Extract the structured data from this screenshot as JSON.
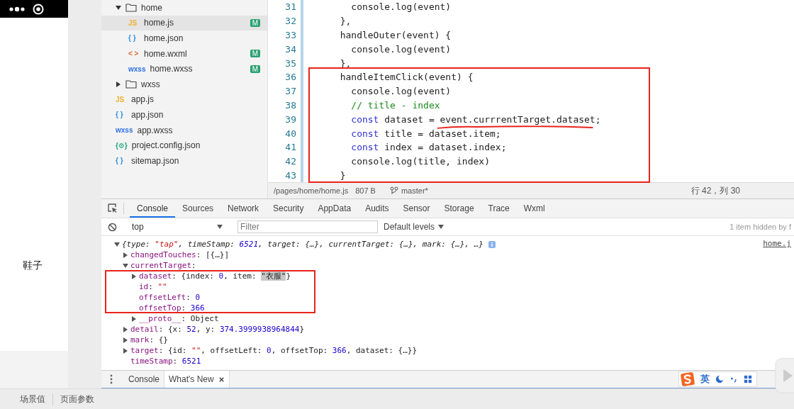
{
  "simulator": {
    "item_label": "鞋子"
  },
  "file_tree": [
    {
      "name": "home",
      "kind": "folder",
      "expanded": true,
      "selected": false,
      "children": [
        {
          "name": "home.js",
          "kind": "js",
          "icon_text": "JS",
          "badge": "M",
          "selected": true
        },
        {
          "name": "home.json",
          "kind": "json",
          "icon_text": "{ }",
          "selected": false
        },
        {
          "name": "home.wxml",
          "kind": "wxml",
          "icon_text": "< >",
          "badge": "M",
          "selected": false
        },
        {
          "name": "home.wxss",
          "kind": "wxss",
          "icon_text": "wxss",
          "badge": "M",
          "selected": false
        }
      ]
    },
    {
      "name": "wxss",
      "kind": "folder",
      "expanded": false,
      "selected": false
    },
    {
      "name": "app.js",
      "kind": "js",
      "icon_text": "JS",
      "selected": false
    },
    {
      "name": "app.json",
      "kind": "json",
      "icon_text": "{ }",
      "selected": false
    },
    {
      "name": "app.wxss",
      "kind": "wxss",
      "icon_text": "wxss",
      "selected": false
    },
    {
      "name": "project.config.json",
      "kind": "config",
      "icon_text": "{⚙}",
      "selected": false
    },
    {
      "name": "sitemap.json",
      "kind": "json",
      "icon_text": "{ }",
      "selected": false
    }
  ],
  "editor": {
    "lines": [
      {
        "number": "31",
        "tokens": [
          {
            "kind": "plain",
            "text": "    console.log(event)"
          }
        ]
      },
      {
        "number": "32",
        "tokens": [
          {
            "kind": "plain",
            "text": "  },"
          }
        ]
      },
      {
        "number": "33",
        "tokens": [
          {
            "kind": "plain",
            "text": "  handleOuter(event) {"
          }
        ]
      },
      {
        "number": "34",
        "tokens": [
          {
            "kind": "plain",
            "text": "    console.log(event)"
          }
        ]
      },
      {
        "number": "35",
        "tokens": [
          {
            "kind": "plain",
            "text": "  },"
          }
        ]
      },
      {
        "number": "36",
        "tokens": [
          {
            "kind": "plain",
            "text": "  handleItemClick(event) {"
          }
        ]
      },
      {
        "number": "37",
        "tokens": [
          {
            "kind": "plain",
            "text": "    console.log(event)"
          }
        ]
      },
      {
        "number": "38",
        "tokens": [
          {
            "kind": "comment",
            "text": "    // title - index"
          }
        ]
      },
      {
        "number": "39",
        "tokens": [
          {
            "kind": "keyword",
            "text": "    const"
          },
          {
            "kind": "plain",
            "text": " dataset = event.currrentTarget.dataset;"
          }
        ]
      },
      {
        "number": "40",
        "tokens": [
          {
            "kind": "keyword",
            "text": "    const"
          },
          {
            "kind": "plain",
            "text": " title = dataset.item;"
          }
        ]
      },
      {
        "number": "41",
        "tokens": [
          {
            "kind": "keyword",
            "text": "    const"
          },
          {
            "kind": "plain",
            "text": " index = dataset.index;"
          }
        ]
      },
      {
        "number": "42",
        "tokens": [
          {
            "kind": "plain",
            "text": "    console.log(title, index)"
          }
        ]
      },
      {
        "number": "43",
        "tokens": [
          {
            "kind": "plain",
            "text": "  }"
          }
        ]
      }
    ],
    "status": {
      "path": "/pages/home/home.js",
      "size": "807 B",
      "branch": "master*",
      "position": "行 42，列 30"
    }
  },
  "devtools": {
    "tabs": [
      {
        "label": "Console",
        "selected": true
      },
      {
        "label": "Sources",
        "selected": false
      },
      {
        "label": "Network",
        "selected": false
      },
      {
        "label": "Security",
        "selected": false
      },
      {
        "label": "AppData",
        "selected": false
      },
      {
        "label": "Audits",
        "selected": false
      },
      {
        "label": "Sensor",
        "selected": false
      },
      {
        "label": "Storage",
        "selected": false
      },
      {
        "label": "Trace",
        "selected": false
      },
      {
        "label": "Wxml",
        "selected": false
      }
    ],
    "context": "top",
    "filter_placeholder": "Filter",
    "levels": "Default levels",
    "hidden_note": "1 item hidden by f",
    "source_link": "home.j",
    "console": [
      {
        "kind": "summary",
        "expanded": true,
        "tokens": [
          {
            "kind": "plain",
            "text": "{type: "
          },
          {
            "kind": "str",
            "text": "\"tap\""
          },
          {
            "kind": "plain",
            "text": ", timeStamp: "
          },
          {
            "kind": "num",
            "text": "6521"
          },
          {
            "kind": "plain",
            "text": ", target: {…}, currentTarget: {…}, mark: {…}, …}"
          }
        ],
        "children": [
          {
            "kind": "property",
            "expanded": false,
            "tokens": [
              {
                "kind": "key",
                "text": "changedTouches"
              },
              {
                "kind": "plain",
                "text": ": [{…}]"
              }
            ]
          },
          {
            "kind": "property",
            "expanded": true,
            "tokens": [
              {
                "kind": "key",
                "text": "currentTarget"
              },
              {
                "kind": "plain",
                "text": ":"
              }
            ],
            "children": [
              {
                "kind": "property",
                "expanded": false,
                "tokens": [
                  {
                    "kind": "key",
                    "text": "dataset"
                  },
                  {
                    "kind": "plain",
                    "text": ": {index: "
                  },
                  {
                    "kind": "num",
                    "text": "0"
                  },
                  {
                    "kind": "plain",
                    "text": ", item: "
                  },
                  {
                    "kind": "hl",
                    "text": "\"衣服\""
                  },
                  {
                    "kind": "plain",
                    "text": "}"
                  }
                ]
              },
              {
                "kind": "property",
                "tokens": [
                  {
                    "kind": "key",
                    "text": "id"
                  },
                  {
                    "kind": "plain",
                    "text": ": "
                  },
                  {
                    "kind": "str",
                    "text": "\"\""
                  }
                ]
              },
              {
                "kind": "property",
                "tokens": [
                  {
                    "kind": "key",
                    "text": "offsetLeft"
                  },
                  {
                    "kind": "plain",
                    "text": ": "
                  },
                  {
                    "kind": "num",
                    "text": "0"
                  }
                ]
              },
              {
                "kind": "property",
                "tokens": [
                  {
                    "kind": "key",
                    "text": "offsetTop"
                  },
                  {
                    "kind": "plain",
                    "text": ": "
                  },
                  {
                    "kind": "num",
                    "text": "366"
                  }
                ]
              },
              {
                "kind": "property",
                "expanded": false,
                "tokens": [
                  {
                    "kind": "key",
                    "text": "__proto__"
                  },
                  {
                    "kind": "plain",
                    "text": ": Object"
                  }
                ]
              }
            ]
          },
          {
            "kind": "property",
            "expanded": false,
            "tokens": [
              {
                "kind": "key",
                "text": "detail"
              },
              {
                "kind": "plain",
                "text": ": {x: "
              },
              {
                "kind": "num",
                "text": "52"
              },
              {
                "kind": "plain",
                "text": ", y: "
              },
              {
                "kind": "num",
                "text": "374.3999938964844"
              },
              {
                "kind": "plain",
                "text": "}"
              }
            ]
          },
          {
            "kind": "property",
            "expanded": false,
            "tokens": [
              {
                "kind": "key",
                "text": "mark"
              },
              {
                "kind": "plain",
                "text": ": {}"
              }
            ]
          },
          {
            "kind": "property",
            "expanded": false,
            "tokens": [
              {
                "kind": "key",
                "text": "target"
              },
              {
                "kind": "plain",
                "text": ": {id: "
              },
              {
                "kind": "str",
                "text": "\"\""
              },
              {
                "kind": "plain",
                "text": ", offsetLeft: "
              },
              {
                "kind": "num",
                "text": "0"
              },
              {
                "kind": "plain",
                "text": ", offsetTop: "
              },
              {
                "kind": "num",
                "text": "366"
              },
              {
                "kind": "plain",
                "text": ", dataset: {…}}"
              }
            ]
          },
          {
            "kind": "property",
            "tokens": [
              {
                "kind": "key",
                "text": "timeStamp"
              },
              {
                "kind": "plain",
                "text": ": "
              },
              {
                "kind": "num",
                "text": "6521"
              }
            ]
          }
        ]
      }
    ],
    "drawer_tabs": [
      {
        "label": "Console",
        "selected": false,
        "closable": false
      },
      {
        "label": "What's New",
        "selected": true,
        "closable": true
      }
    ]
  },
  "ime": {
    "mode": "英"
  },
  "bottom_bar": [
    "场景值",
    "页面参数"
  ]
}
